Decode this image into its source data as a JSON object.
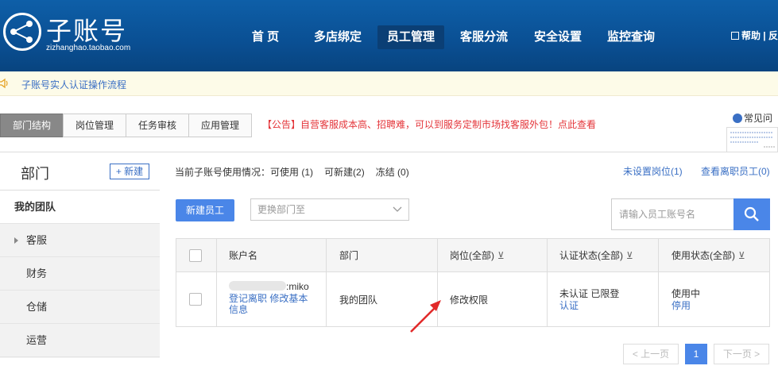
{
  "header": {
    "logo_title": "子账号",
    "logo_sub": "zizhanghao.taobao.com",
    "nav": [
      "首 页",
      "多店绑定",
      "员工管理",
      "客服分流",
      "安全设置",
      "监控查询"
    ],
    "help": "帮助 | 反"
  },
  "notice": {
    "text": "子账号实人认证操作流程"
  },
  "tabs": [
    "部门结构",
    "岗位管理",
    "任务审核",
    "应用管理"
  ],
  "announce": "【公告】自营客服成本高、招聘难，可以到服务定制市场找客服外包！点此查看",
  "faq": "常见问",
  "sidebar": {
    "title": "部门",
    "new_label": "+ 新建",
    "team": "我的团队",
    "items": [
      "客服",
      "财务",
      "仓储",
      "运营"
    ]
  },
  "usage": {
    "prefix": "当前子账号使用情况：",
    "available": "可使用 (1)",
    "can_create": "可新建(2)",
    "frozen": "冻结 (0)",
    "unassigned": "未设置岗位(1)",
    "resigned": "查看离职员工(0)"
  },
  "toolbar": {
    "new_employee": "新建员工",
    "change_dept": "更换部门至",
    "search_placeholder": "请输入员工账号名"
  },
  "table": {
    "headers": [
      "账户名",
      "部门",
      "岗位(全部)",
      "认证状态(全部)",
      "使用状态(全部)"
    ],
    "row": {
      "account": ":miko",
      "account_links": "登记离职 修改基本信息",
      "department": "我的团队",
      "position_link": "修改权限",
      "auth_status": "未认证 已限登",
      "auth_link": "认证",
      "use_status": "使用中",
      "use_link": "停用"
    }
  },
  "pagination": {
    "prev": "< 上一页",
    "current": "1",
    "next": "下一页 >"
  },
  "colors": {
    "header_blue": "#0a4f93",
    "link_blue": "#3a6fc4",
    "accent": "#4a86e8",
    "notice_red": "#e4353a"
  }
}
